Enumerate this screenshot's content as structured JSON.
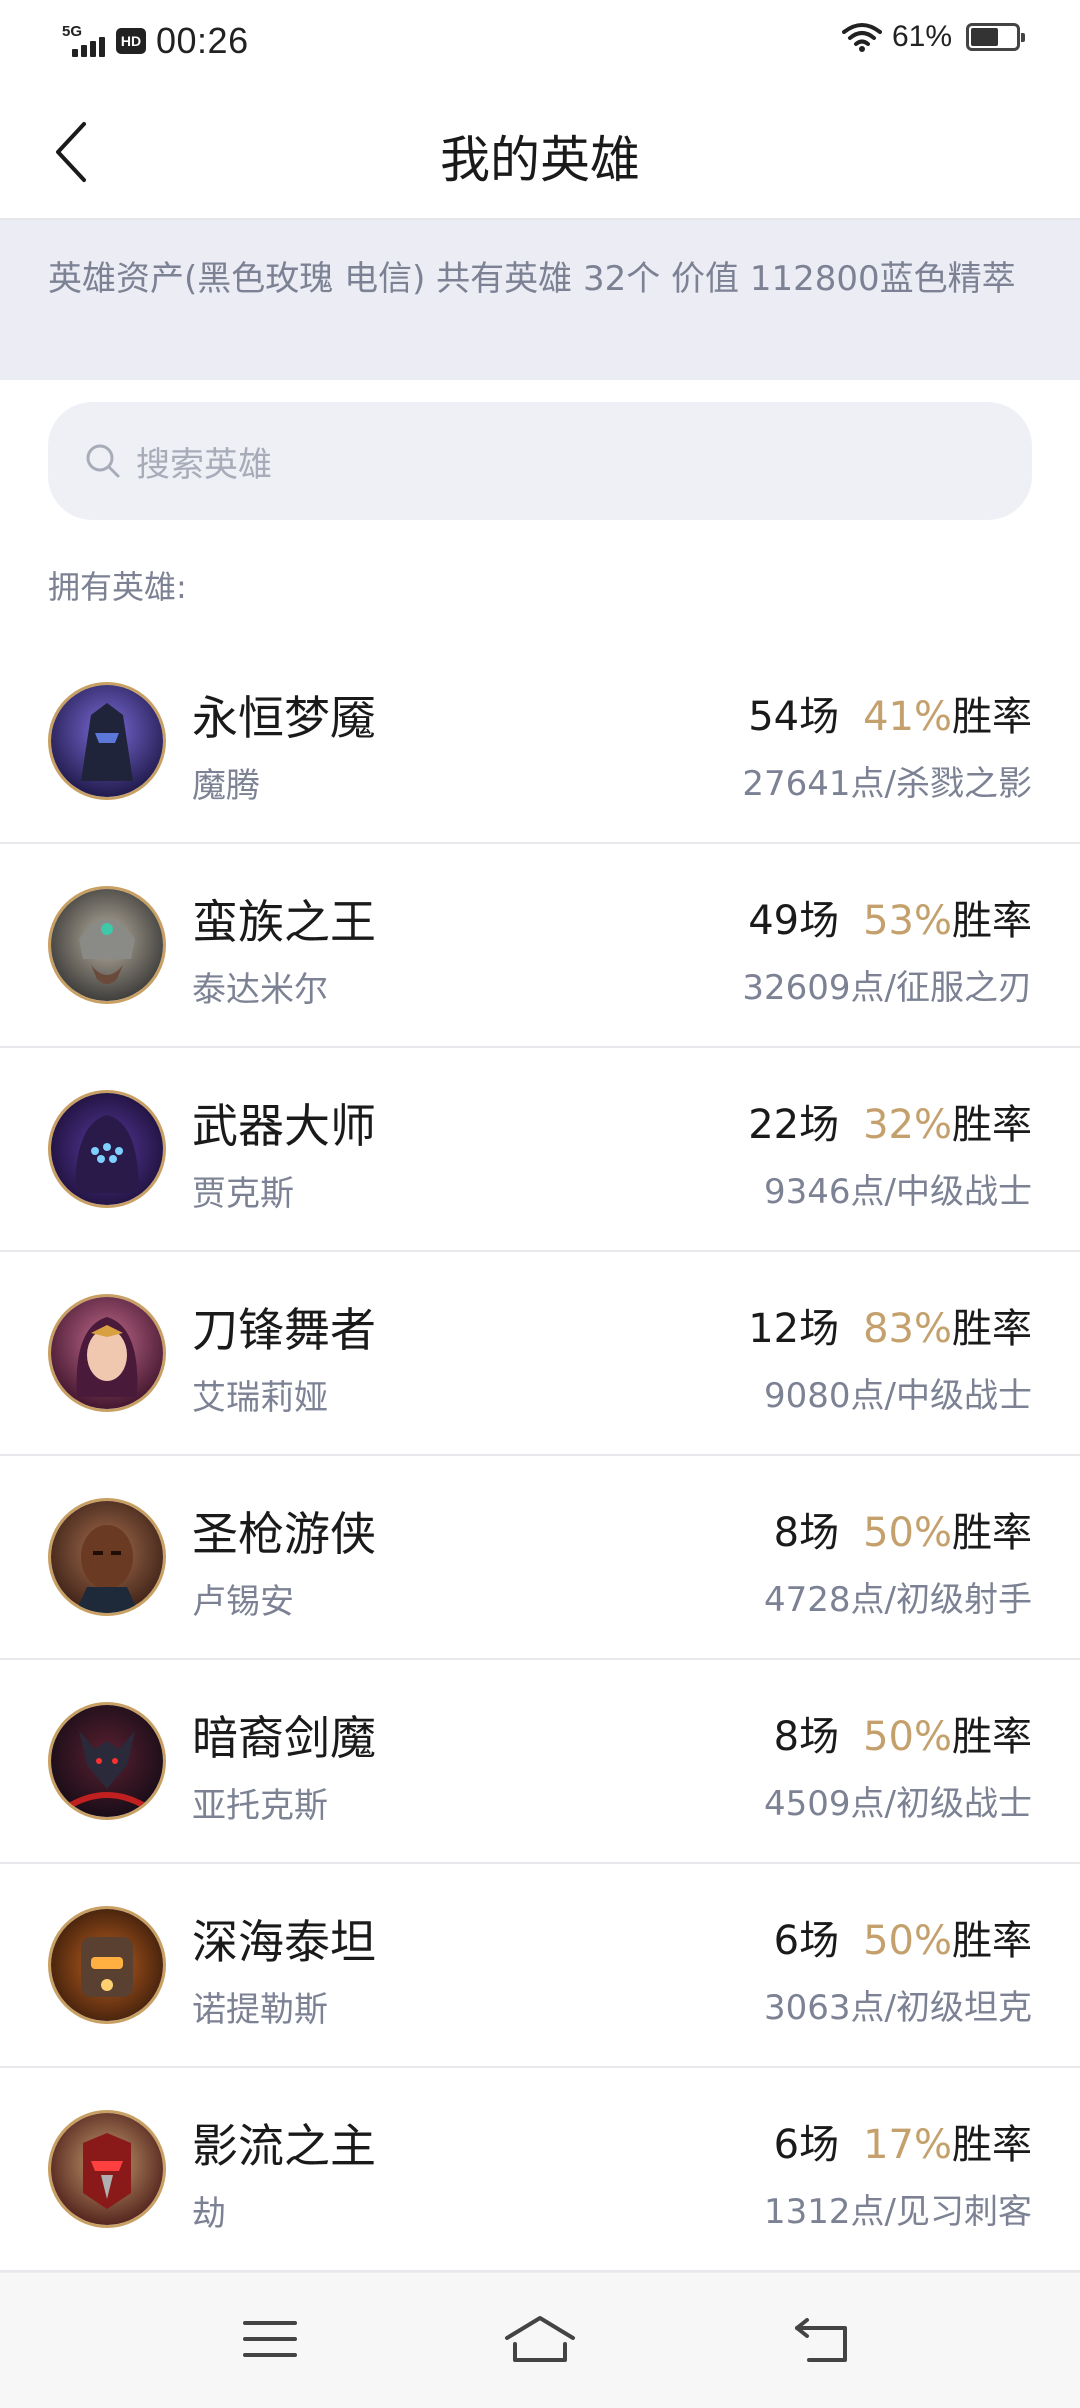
{
  "status_bar": {
    "network": "5G",
    "hd": "HD",
    "time": "00:26",
    "battery_pct": "61%",
    "battery_level": 0.61
  },
  "header": {
    "title": "我的英雄",
    "back_icon": "chevron-left-icon"
  },
  "asset_banner": {
    "text": "英雄资产(黑色玫瑰 电信)  共有英雄 32个  价值 112800蓝色精萃"
  },
  "search": {
    "placeholder": "搜索英雄",
    "icon": "search-icon"
  },
  "owned_label": "拥有英雄:",
  "heroes": [
    {
      "title": "永恒梦魇",
      "name": "魔腾",
      "games": "54场",
      "win_rate": "41%",
      "win_label": "胜率",
      "points": "27641点/杀戮之影"
    },
    {
      "title": "蛮族之王",
      "name": "泰达米尔",
      "games": "49场",
      "win_rate": "53%",
      "win_label": "胜率",
      "points": "32609点/征服之刃"
    },
    {
      "title": "武器大师",
      "name": "贾克斯",
      "games": "22场",
      "win_rate": "32%",
      "win_label": "胜率",
      "points": "9346点/中级战士"
    },
    {
      "title": "刀锋舞者",
      "name": "艾瑞莉娅",
      "games": "12场",
      "win_rate": "83%",
      "win_label": "胜率",
      "points": "9080点/中级战士"
    },
    {
      "title": "圣枪游侠",
      "name": "卢锡安",
      "games": "8场",
      "win_rate": "50%",
      "win_label": "胜率",
      "points": "4728点/初级射手"
    },
    {
      "title": "暗裔剑魔",
      "name": "亚托克斯",
      "games": "8场",
      "win_rate": "50%",
      "win_label": "胜率",
      "points": "4509点/初级战士"
    },
    {
      "title": "深海泰坦",
      "name": "诺提勒斯",
      "games": "6场",
      "win_rate": "50%",
      "win_label": "胜率",
      "points": "3063点/初级坦克"
    },
    {
      "title": "影流之主",
      "name": "劫",
      "games": "6场",
      "win_rate": "17%",
      "win_label": "胜率",
      "points": "1312点/见习刺客"
    }
  ],
  "colors": {
    "win_rate": "#c4a06c",
    "banner_bg": "#ebecf4",
    "avatar_ring": "#c9a064"
  },
  "nav_bar": {
    "menu_icon": "menu-icon",
    "home_icon": "home-icon",
    "back_icon": "return-icon"
  }
}
